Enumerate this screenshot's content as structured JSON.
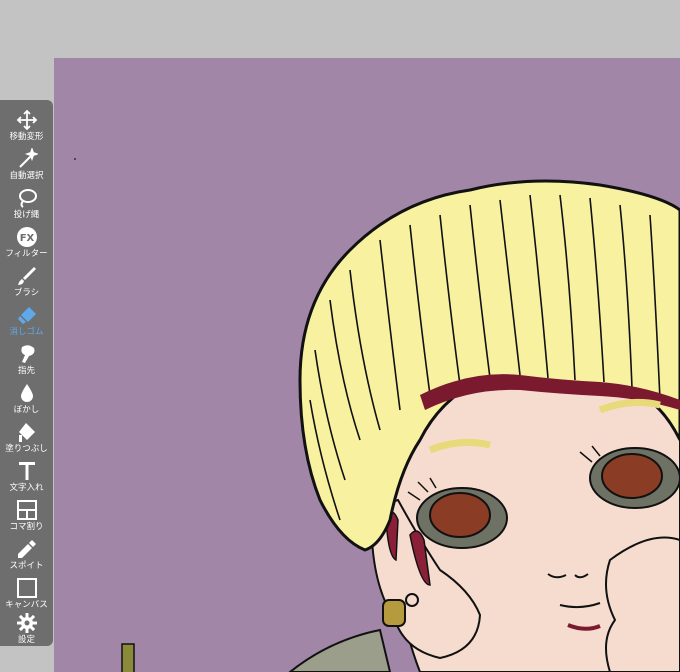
{
  "app": {
    "background_color": "#c3c3c3",
    "canvas_color": "#a186a8",
    "toolbar_color": "#6e6e6e",
    "active_color": "#5fa8ea"
  },
  "toolbar": {
    "tools": [
      {
        "id": "move",
        "label": "移動変形",
        "icon": "move-arrows-icon",
        "active": false
      },
      {
        "id": "magic",
        "label": "自動選択",
        "icon": "magic-wand-icon",
        "active": false
      },
      {
        "id": "lasso",
        "label": "投げ縄",
        "icon": "lasso-icon",
        "active": false
      },
      {
        "id": "filter",
        "label": "フィルター",
        "icon": "fx-icon",
        "active": false
      },
      {
        "id": "brush",
        "label": "ブラシ",
        "icon": "brush-icon",
        "active": false
      },
      {
        "id": "eraser",
        "label": "消しゴム",
        "icon": "eraser-icon",
        "active": true
      },
      {
        "id": "smudge",
        "label": "指先",
        "icon": "finger-icon",
        "active": false
      },
      {
        "id": "blur",
        "label": "ぼかし",
        "icon": "drop-icon",
        "active": false
      },
      {
        "id": "fill",
        "label": "塗りつぶし",
        "icon": "bucket-icon",
        "active": false
      },
      {
        "id": "text",
        "label": "文字入れ",
        "icon": "text-icon",
        "active": false
      },
      {
        "id": "frame",
        "label": "コマ割り",
        "icon": "frame-divider-icon",
        "active": false
      },
      {
        "id": "eyedropper",
        "label": "スポイト",
        "icon": "eyedropper-icon",
        "active": false
      },
      {
        "id": "canvas",
        "label": "キャンバス",
        "icon": "canvas-icon",
        "active": false
      },
      {
        "id": "settings",
        "label": "設定",
        "icon": "gear-icon",
        "active": false
      }
    ]
  }
}
